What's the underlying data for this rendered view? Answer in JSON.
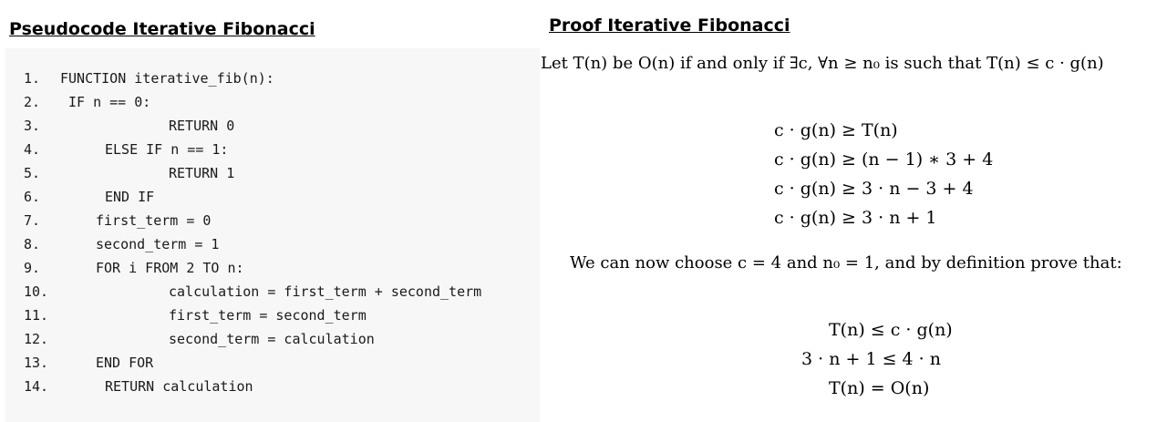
{
  "left_heading": "Pseudocode Iterative Fibonacci",
  "right_heading": "Proof Iterative Fibonacci",
  "code": [
    {
      "num": "1.",
      "text": "FUNCTION iterative_fib(n):"
    },
    {
      "num": "2.",
      "text": "IF n == 0:"
    },
    {
      "num": "3.",
      "text": "RETURN 0"
    },
    {
      "num": "4.",
      "text": "ELSE IF n == 1:"
    },
    {
      "num": "5.",
      "text": "RETURN 1"
    },
    {
      "num": "6.",
      "text": "END IF"
    },
    {
      "num": "7.",
      "text": "first_term = 0"
    },
    {
      "num": "8.",
      "text": "second_term = 1"
    },
    {
      "num": "9.",
      "text": "FOR i FROM 2 TO n:"
    },
    {
      "num": "10.",
      "text": "calculation = first_term + second_term"
    },
    {
      "num": "11.",
      "text": "first_term = second_term"
    },
    {
      "num": "12.",
      "text": "second_term = calculation"
    },
    {
      "num": "13.",
      "text": "END FOR"
    },
    {
      "num": "14.",
      "text": "RETURN calculation"
    }
  ],
  "proof": {
    "definition": "Let T(n) be O(n) if and only if ∃c, ∀n ≥ n₀ is such that T(n) ≤ c · g(n)",
    "steps": [
      "c · g(n) ≥ T(n)",
      "c · g(n) ≥ (n − 1) ∗ 3 + 4",
      "c · g(n) ≥ 3 · n − 3 + 4",
      "c · g(n) ≥ 3 · n + 1"
    ],
    "choice": "We can now choose c = 4 and n₀ = 1, and by definition prove that:",
    "conclusion": [
      "T(n) ≤ c · g(n)",
      "3 · n + 1 ≤ 4 · n",
      "T(n) = O(n)"
    ]
  }
}
